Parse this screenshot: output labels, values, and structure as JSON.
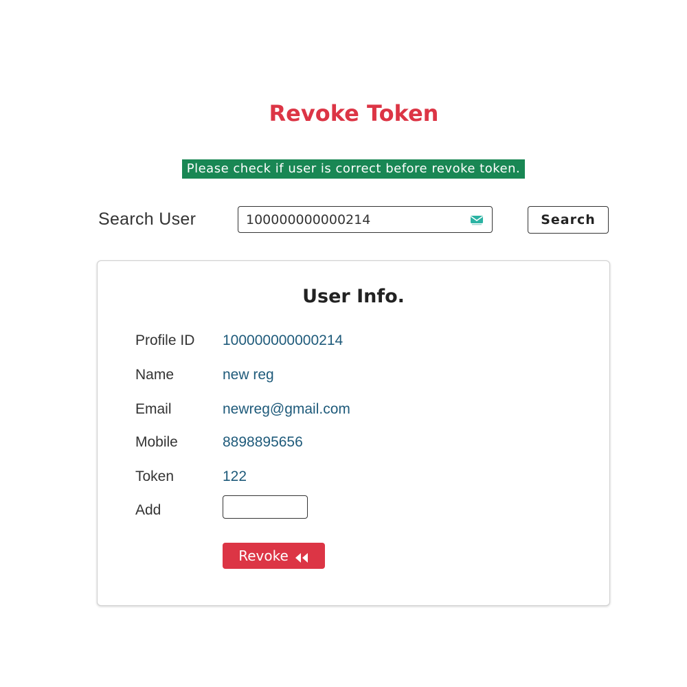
{
  "page": {
    "title": "Revoke Token",
    "warning": "Please check if user is correct before revoke token."
  },
  "search": {
    "label": "Search User",
    "value": "100000000000214",
    "icon": "envelope-icon",
    "button_label": "Search"
  },
  "user_info": {
    "title": "User Info.",
    "fields": [
      {
        "label": "Profile ID",
        "value": "100000000000214"
      },
      {
        "label": "Name",
        "value": "new reg"
      },
      {
        "label": "Email",
        "value": "newreg@gmail.com"
      },
      {
        "label": "Mobile",
        "value": "8898895656"
      },
      {
        "label": "Token",
        "value": "122"
      }
    ],
    "add": {
      "label": "Add",
      "value": ""
    },
    "revoke_label": "Revoke",
    "revoke_icon": "rewind-icon"
  },
  "colors": {
    "title": "#dc3545",
    "warning_bg": "#198754",
    "value_text": "#1e5a7a",
    "revoke_bg": "#dc3545"
  }
}
